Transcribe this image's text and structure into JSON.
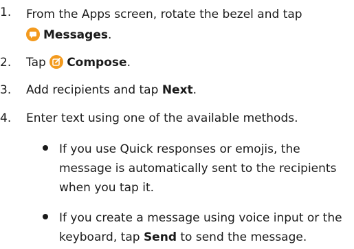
{
  "steps": [
    {
      "number": "1.",
      "line1": "From the Apps screen, rotate the bezel and tap",
      "icon": "messages-icon",
      "label": "Messages",
      "suffix": "."
    },
    {
      "number": "2.",
      "prefix": "Tap",
      "icon": "compose-icon",
      "label": "Compose",
      "suffix": "."
    },
    {
      "number": "3.",
      "prefix": "Add recipients and tap ",
      "label": "Next",
      "suffix": "."
    },
    {
      "number": "4.",
      "text": "Enter text using one of the available methods."
    }
  ],
  "bullets": [
    {
      "text": "If you use Quick responses or emojis, the message is automatically sent to the recipients when you tap it."
    },
    {
      "prefix": "If you create a message using voice input or the keyboard, tap ",
      "label": "Send",
      "suffix": " to send the message."
    }
  ],
  "colors": {
    "icon_orange": "#f39a1e",
    "text": "#1a1a1a"
  }
}
